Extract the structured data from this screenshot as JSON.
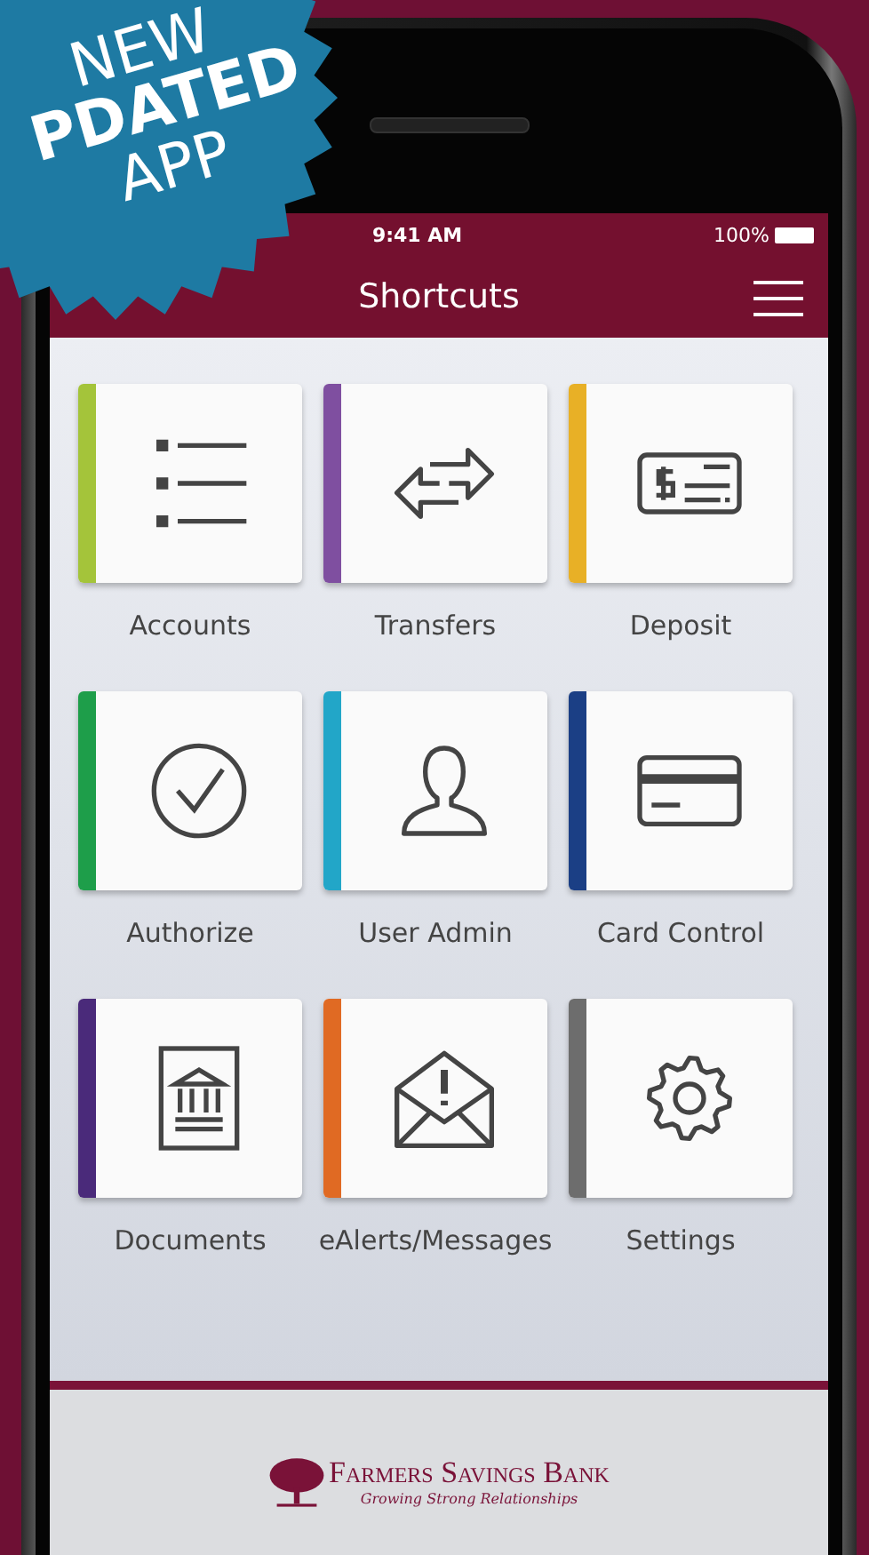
{
  "badge": {
    "lines": [
      "NEW",
      "PDATED",
      "APP"
    ]
  },
  "status_bar": {
    "time": "9:41 AM",
    "battery": "100%"
  },
  "header": {
    "title": "Shortcuts"
  },
  "shortcuts": [
    {
      "label": "Accounts",
      "kind": "accounts",
      "color": "#a4c43a"
    },
    {
      "label": "Transfers",
      "kind": "transfers",
      "color": "#7f4fa0"
    },
    {
      "label": "Deposit",
      "kind": "deposit",
      "color": "#e8b026"
    },
    {
      "label": "Authorize",
      "kind": "authorize",
      "color": "#1e9e4a"
    },
    {
      "label": "User Admin",
      "kind": "user",
      "color": "#22a6c8"
    },
    {
      "label": "Card Control",
      "kind": "card",
      "color": "#1b3f85"
    },
    {
      "label": "Documents",
      "kind": "documents",
      "color": "#4a2a7a"
    },
    {
      "label": "eAlerts/Messages",
      "kind": "alerts",
      "color": "#e06a23"
    },
    {
      "label": "Settings",
      "kind": "settings",
      "color": "#6d6d6d"
    }
  ],
  "footer": {
    "bank_name": "Farmers Savings Bank",
    "tagline": "Growing Strong Relationships"
  }
}
